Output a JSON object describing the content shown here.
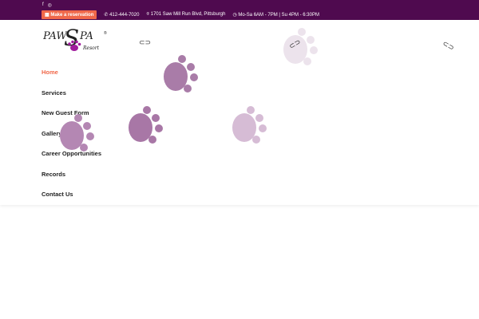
{
  "topbar": {
    "social": [
      "facebook-icon",
      "instagram-icon"
    ],
    "reservation_label": "Make a reservation",
    "phone": "412-444-7020",
    "address": "1701 Saw Mill Run Blvd, Pittsburgh",
    "hours": "Mo-Sa 6AM - 7PM | Su 4PM - 6:30PM"
  },
  "logo": {
    "text": "PAW SPA",
    "sub": "Resort"
  },
  "nav": [
    "Home",
    "Services",
    "New Guest Form",
    "Gallery",
    "Career Opportunities",
    "Records",
    "Contact Us"
  ],
  "colors": {
    "topbar": "#4f0a4f",
    "accent": "#f0684a"
  }
}
